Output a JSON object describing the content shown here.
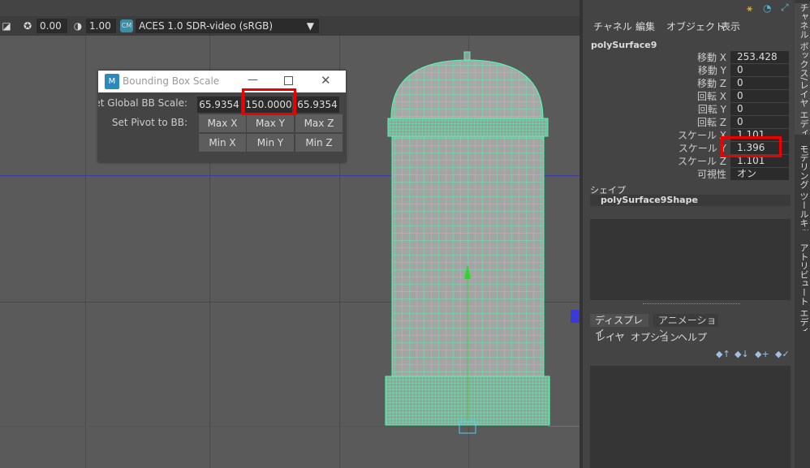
{
  "toolbar": {
    "exposure_value": "0.00",
    "gamma_value": "1.00",
    "view_transform": "ACES 1.0 SDR-video (sRGB)"
  },
  "dialog": {
    "title": "Bounding Box Scale",
    "global_label": "et Global BB Scale:",
    "scale_x": "65.9354",
    "scale_y": "150.0000",
    "scale_z": "65.9354",
    "pivot_label": "Set Pivot to BB:",
    "max_x": "Max  X",
    "max_y": "Max  Y",
    "max_z": "Max  Z",
    "min_x": "Min  X",
    "min_y": "Min  Y",
    "min_z": "Min  Z"
  },
  "channel_box": {
    "menus": [
      "チャネル",
      "編集",
      "オブジェクト",
      "表示"
    ],
    "object_name": "polySurface9",
    "attributes": [
      {
        "label": "移動 X",
        "value": "253.428"
      },
      {
        "label": "移動 Y",
        "value": "0"
      },
      {
        "label": "移動 Z",
        "value": "0"
      },
      {
        "label": "回転 X",
        "value": "0"
      },
      {
        "label": "回転 Y",
        "value": "0"
      },
      {
        "label": "回転 Z",
        "value": "0"
      },
      {
        "label": "スケール X",
        "value": "1.101"
      },
      {
        "label": "スケール Y",
        "value": "1.396"
      },
      {
        "label": "スケール Z",
        "value": "1.101"
      },
      {
        "label": "可視性",
        "value": "オン"
      }
    ],
    "shape_header": "シェイプ",
    "shape_name": "polySurface9Shape"
  },
  "layer_editor": {
    "tabs": [
      "ディスプレイ",
      "アニメーション"
    ],
    "menus": [
      "レイヤ",
      "オプション",
      "ヘルプ"
    ]
  },
  "side_tabs": [
    "チャネル ボックス/レイヤ エディタ",
    "モデリング ツールキット",
    "アトリビュート エディタ"
  ],
  "colors": {
    "wireframe": "#4dffb0",
    "highlight": "#ee0000"
  }
}
